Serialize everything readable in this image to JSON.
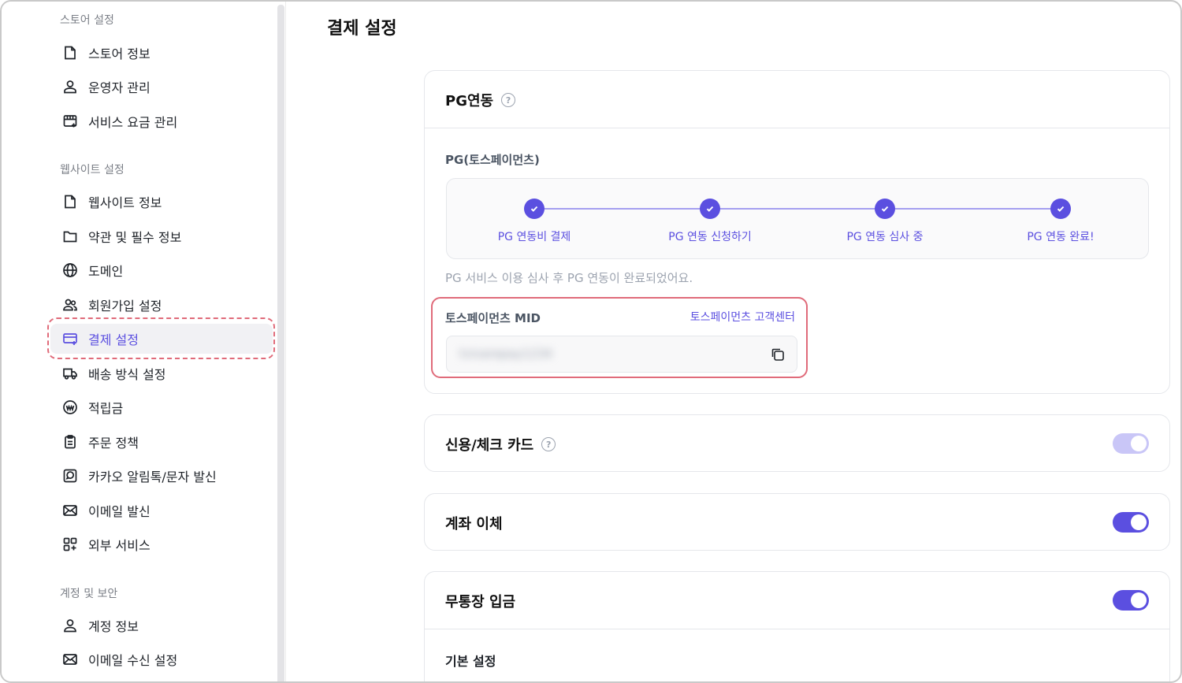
{
  "sidebar": {
    "sections": [
      {
        "title": "스토어 설정",
        "items": [
          {
            "label": "스토어 정보",
            "icon": "document-icon"
          },
          {
            "label": "운영자 관리",
            "icon": "user-manage-icon"
          },
          {
            "label": "서비스 요금 관리",
            "icon": "calendar-plus-icon"
          }
        ]
      },
      {
        "title": "웹사이트 설정",
        "items": [
          {
            "label": "웹사이트 정보",
            "icon": "document-icon"
          },
          {
            "label": "약관 및 필수 정보",
            "icon": "folder-icon"
          },
          {
            "label": "도메인",
            "icon": "globe-icon"
          },
          {
            "label": "회원가입 설정",
            "icon": "users-icon"
          },
          {
            "label": "결제 설정",
            "icon": "card-plus-icon",
            "active": true
          },
          {
            "label": "배송 방식 설정",
            "icon": "truck-icon"
          },
          {
            "label": "적립금",
            "icon": "coin-icon"
          },
          {
            "label": "주문 정책",
            "icon": "clipboard-icon"
          },
          {
            "label": "카카오 알림톡/문자 발신",
            "icon": "chat-icon"
          },
          {
            "label": "이메일 발신",
            "icon": "mail-icon"
          },
          {
            "label": "외부 서비스",
            "icon": "apps-icon"
          }
        ]
      },
      {
        "title": "계정 및 보안",
        "items": [
          {
            "label": "계정 정보",
            "icon": "user-icon"
          },
          {
            "label": "이메일 수신 설정",
            "icon": "mail-icon"
          }
        ]
      }
    ]
  },
  "main": {
    "title": "결제 설정",
    "pg_card": {
      "title": "PG연동",
      "pg_label": "PG(토스페이먼츠)",
      "steps": [
        "PG 연동비 결제",
        "PG 연동 신청하기",
        "PG 연동 심사 중",
        "PG 연동 완료!"
      ],
      "note": "PG 서비스 이용 심사 후 PG 연동이 완료되었어요.",
      "mid_label": "토스페이먼츠 MID",
      "mid_link": "토스페이먼츠 고객센터",
      "mid_value": "tvivarepay1234"
    },
    "credit_card": {
      "title": "신용/체크 카드",
      "enabled": true,
      "disabled_style": true
    },
    "bank_transfer": {
      "title": "계좌 이체",
      "enabled": true
    },
    "deposit": {
      "title": "무통장 입금",
      "enabled": true,
      "sub_label": "기본 설정"
    }
  },
  "colors": {
    "accent": "#5b4fe0",
    "highlight": "#e06b7a"
  }
}
